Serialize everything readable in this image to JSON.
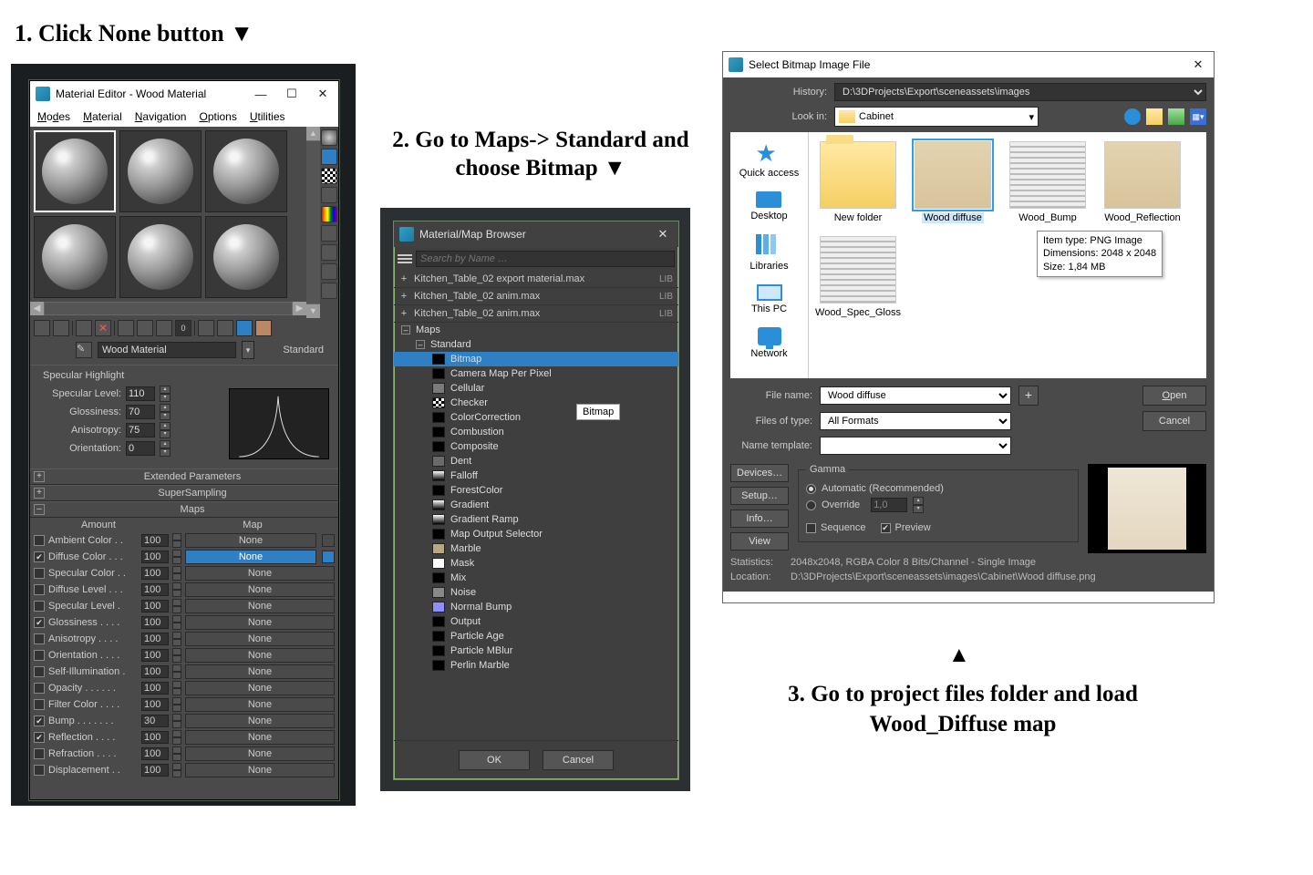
{
  "instructions": {
    "s1": "1. Click None button ▼",
    "s2": "2. Go to Maps-> Standard and choose Bitmap ▼",
    "s3a": "▲",
    "s3": "3. Go to project files folder and load Wood_Diffuse map"
  },
  "matEditor": {
    "title": "Material Editor - Wood Material",
    "menus": [
      "Modes",
      "Material",
      "Navigation",
      "Options",
      "Utilities"
    ],
    "materialName": "Wood Material",
    "shaderType": "Standard",
    "specHeader": "Specular Highlight",
    "specParams": {
      "specLevelLbl": "Specular Level:",
      "specLevel": "110",
      "glossLbl": "Glossiness:",
      "gloss": "70",
      "anisoLbl": "Anisotropy:",
      "aniso": "75",
      "orientLbl": "Orientation:",
      "orient": "0"
    },
    "rollouts": {
      "ext": "Extended Parameters",
      "ss": "SuperSampling",
      "maps": "Maps"
    },
    "mapsCols": {
      "amount": "Amount",
      "map": "Map"
    },
    "mapRows": [
      {
        "on": false,
        "name": "Ambient Color . .",
        "amt": "100",
        "btn": "None",
        "sel": false,
        "lock": true
      },
      {
        "on": true,
        "name": "Diffuse Color . . .",
        "amt": "100",
        "btn": "None",
        "sel": true,
        "lock": false
      },
      {
        "on": false,
        "name": "Specular Color . .",
        "amt": "100",
        "btn": "None",
        "sel": false,
        "lock": false
      },
      {
        "on": false,
        "name": "Diffuse Level . . .",
        "amt": "100",
        "btn": "None",
        "sel": false,
        "lock": false
      },
      {
        "on": false,
        "name": "Specular Level .",
        "amt": "100",
        "btn": "None",
        "sel": false,
        "lock": false
      },
      {
        "on": true,
        "name": "Glossiness . . . .",
        "amt": "100",
        "btn": "None",
        "sel": false,
        "lock": false
      },
      {
        "on": false,
        "name": "Anisotropy . . . .",
        "amt": "100",
        "btn": "None",
        "sel": false,
        "lock": false
      },
      {
        "on": false,
        "name": "Orientation . . . .",
        "amt": "100",
        "btn": "None",
        "sel": false,
        "lock": false
      },
      {
        "on": false,
        "name": "Self-Illumination .",
        "amt": "100",
        "btn": "None",
        "sel": false,
        "lock": false
      },
      {
        "on": false,
        "name": "Opacity . . . . . .",
        "amt": "100",
        "btn": "None",
        "sel": false,
        "lock": false
      },
      {
        "on": false,
        "name": "Filter Color . . . .",
        "amt": "100",
        "btn": "None",
        "sel": false,
        "lock": false
      },
      {
        "on": true,
        "name": "Bump . . . . . . .",
        "amt": "30",
        "btn": "None",
        "sel": false,
        "lock": false
      },
      {
        "on": true,
        "name": "Reflection . . . .",
        "amt": "100",
        "btn": "None",
        "sel": false,
        "lock": false
      },
      {
        "on": false,
        "name": "Refraction . . . .",
        "amt": "100",
        "btn": "None",
        "sel": false,
        "lock": false
      },
      {
        "on": false,
        "name": "Displacement . .",
        "amt": "100",
        "btn": "None",
        "sel": false,
        "lock": false
      }
    ]
  },
  "browser": {
    "title": "Material/Map Browser",
    "searchPH": "Search by Name …",
    "libs": [
      "Kitchen_Table_02  export material.max",
      "Kitchen_Table_02 anim.max",
      "Kitchen_Table_02 anim.max"
    ],
    "libTag": "LIB",
    "mapsLbl": "Maps",
    "stdLbl": "Standard",
    "items": [
      {
        "name": "Bitmap",
        "sel": true,
        "sw": "#000"
      },
      {
        "name": "Camera Map Per Pixel",
        "sw": "#000"
      },
      {
        "name": "Cellular",
        "sw": "#7a7a7a"
      },
      {
        "name": "Checker",
        "sw": "check"
      },
      {
        "name": "ColorCorrection",
        "sw": "#000"
      },
      {
        "name": "Combustion",
        "sw": "#000"
      },
      {
        "name": "Composite",
        "sw": "#000"
      },
      {
        "name": "Dent",
        "sw": "#6a6a6a"
      },
      {
        "name": "Falloff",
        "sw": "grad"
      },
      {
        "name": "ForestColor",
        "sw": "#000"
      },
      {
        "name": "Gradient",
        "sw": "grad"
      },
      {
        "name": "Gradient Ramp",
        "sw": "grad"
      },
      {
        "name": "Map Output Selector",
        "sw": "#000"
      },
      {
        "name": "Marble",
        "sw": "#b7a884"
      },
      {
        "name": "Mask",
        "sw": "#fff"
      },
      {
        "name": "Mix",
        "sw": "#000"
      },
      {
        "name": "Noise",
        "sw": "#888"
      },
      {
        "name": "Normal Bump",
        "sw": "#8e8eff"
      },
      {
        "name": "Output",
        "sw": "#000"
      },
      {
        "name": "Particle Age",
        "sw": "#000"
      },
      {
        "name": "Particle MBlur",
        "sw": "#000"
      },
      {
        "name": "Perlin Marble",
        "sw": "#000"
      }
    ],
    "tooltip": "Bitmap",
    "ok": "OK",
    "cancel": "Cancel"
  },
  "fileDlg": {
    "title": "Select Bitmap Image File",
    "historyLbl": "History:",
    "history": "D:\\3DProjects\\Export\\sceneassets\\images",
    "lookinLbl": "Look in:",
    "lookin": "Cabinet",
    "places": [
      "Quick access",
      "Desktop",
      "Libraries",
      "This PC",
      "Network"
    ],
    "thumbs": [
      {
        "name": "New folder",
        "type": "folder"
      },
      {
        "name": "Wood diffuse",
        "type": "wood",
        "sel": true
      },
      {
        "name": "Wood_Bump",
        "type": "lines"
      },
      {
        "name": "Wood_Reflection",
        "type": "wood"
      },
      {
        "name": "Wood_Spec_Gloss",
        "type": "lines"
      }
    ],
    "tooltip": {
      "l1": "Item type: PNG Image",
      "l2": "Dimensions: 2048 x 2048",
      "l3": "Size: 1,84 MB"
    },
    "fileNameLbl": "File name:",
    "fileName": "Wood diffuse",
    "fileTypeLbl": "Files of type:",
    "fileType": "All Formats",
    "nameTplLbl": "Name template:",
    "nameTpl": "",
    "plus": "+",
    "open": "Open",
    "cancel": "Cancel",
    "devices": "Devices…",
    "setup": "Setup…",
    "info": "Info…",
    "view": "View",
    "gammaLbl": "Gamma",
    "gammaAuto": "Automatic (Recommended)",
    "gammaOver": "Override",
    "gammaVal": "1,0",
    "seqLbl": "Sequence",
    "prevLbl": "Preview",
    "statsLbl": "Statistics:",
    "stats": "2048x2048, RGBA Color 8 Bits/Channel - Single Image",
    "locLbl": "Location:",
    "loc": "D:\\3DProjects\\Export\\sceneassets\\images\\Cabinet\\Wood diffuse.png"
  }
}
